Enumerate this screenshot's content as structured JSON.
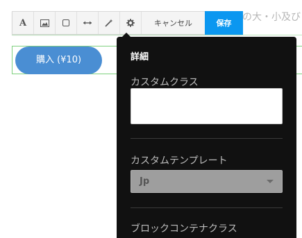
{
  "background": {
    "heading_fragment": "の大・小及び",
    "buy_button_label": "購入 (¥10)"
  },
  "toolbar": {
    "tools": [
      {
        "name": "text-tool",
        "icon": "text-icon"
      },
      {
        "name": "image-tool",
        "icon": "image-icon"
      },
      {
        "name": "box-tool",
        "icon": "square-icon"
      },
      {
        "name": "width-tool",
        "icon": "horizontal-arrows-icon"
      },
      {
        "name": "magic-tool",
        "icon": "magic-wand-icon"
      },
      {
        "name": "settings-tool",
        "icon": "gear-icon"
      }
    ],
    "text_tool_glyph": "A",
    "cancel_label": "キャンセル",
    "save_label": "保存",
    "save_color": "#0b97f0"
  },
  "panel": {
    "title": "詳細",
    "custom_class_label": "カスタムクラス",
    "custom_class_value": "",
    "custom_template_label": "カスタムテンプレート",
    "custom_template_value": "Jp",
    "block_container_class_label": "ブロックコンテナクラス"
  },
  "colors": {
    "panel_bg": "#111111",
    "button_blue": "#4a8ed3",
    "outline_green": "#7fd07f"
  }
}
